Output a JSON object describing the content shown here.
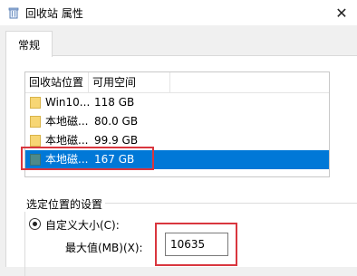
{
  "window": {
    "title": "回收站 属性",
    "close_glyph": "✕",
    "title_icon": "recycle-bin-icon"
  },
  "tabs": [
    {
      "label": "常规",
      "active": true
    }
  ],
  "list": {
    "columns": [
      "回收站位置",
      "可用空间"
    ],
    "rows": [
      {
        "name": "Win10...",
        "size": "118 GB",
        "selected": false
      },
      {
        "name": "本地磁...",
        "size": "80.0 GB",
        "selected": false
      },
      {
        "name": "本地磁...",
        "size": "99.9 GB",
        "selected": false
      },
      {
        "name": "本地磁...",
        "size": "167 GB",
        "selected": true
      }
    ]
  },
  "settings": {
    "group_title": "选定位置的设置",
    "custom_size_label": "自定义大小(C):",
    "max_label": "最大值(MB)(X):",
    "max_value": "10635"
  },
  "colors": {
    "selection": "#0078d7",
    "highlight_box": "#d9363e",
    "folder": "#f7d674"
  }
}
